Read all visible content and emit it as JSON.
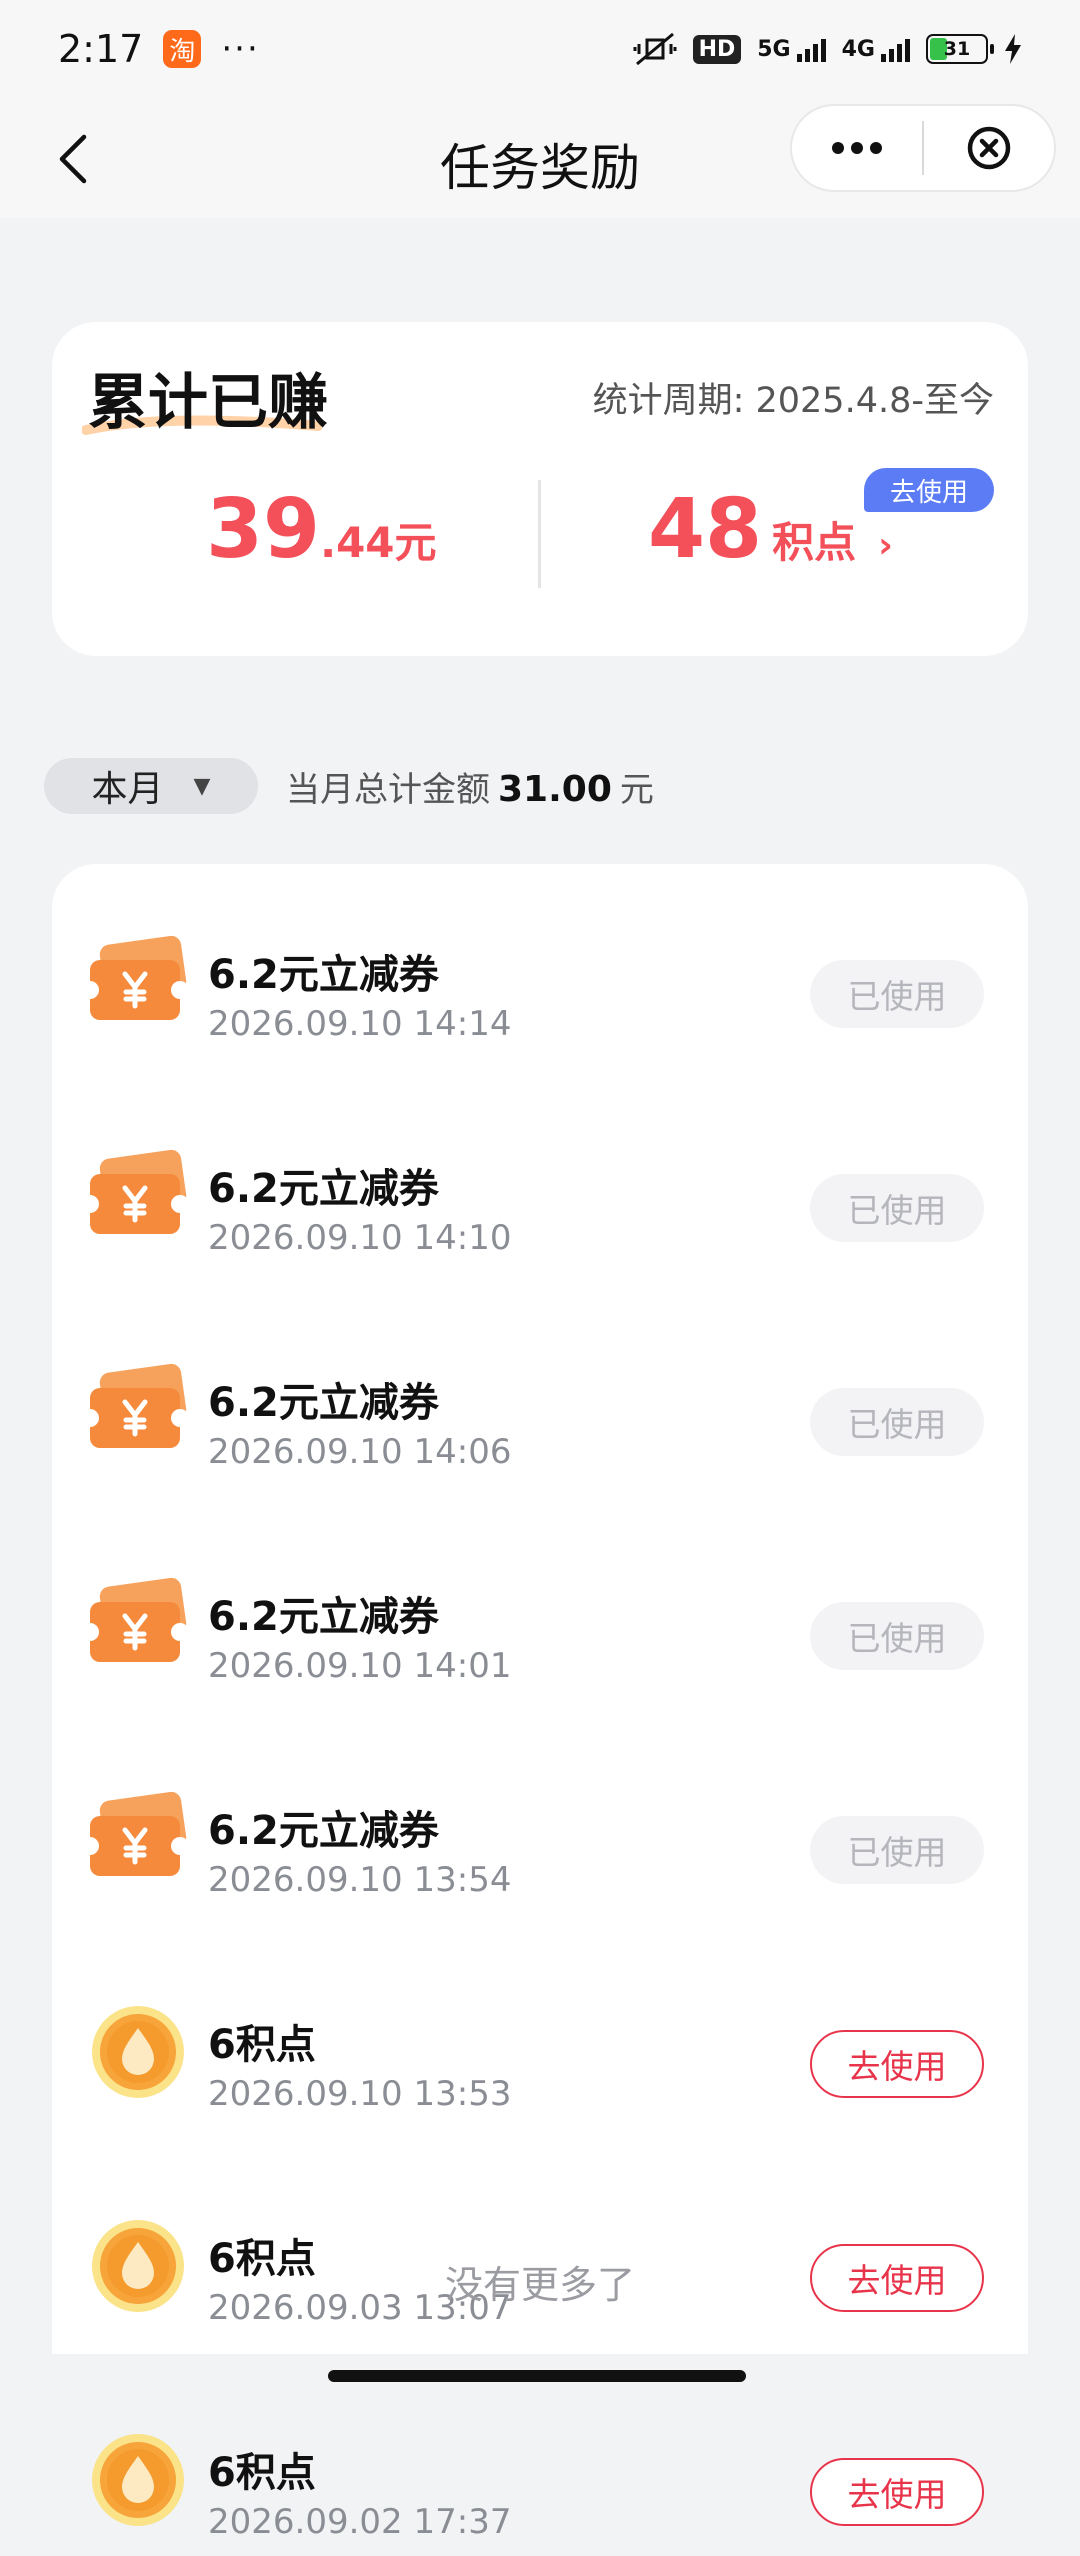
{
  "status_bar": {
    "time": "2:17",
    "app_badge": "淘",
    "more": "···",
    "hd": "HD",
    "net1": "5G",
    "net2": "4G",
    "battery": "31"
  },
  "nav": {
    "title": "任务奖励"
  },
  "summary": {
    "title": "累计已赚",
    "period": "统计周期: 2025.4.8-至今",
    "cash_int": "39",
    "cash_dec": ".44",
    "cash_unit": "元",
    "points_value": "48",
    "points_unit": "积点",
    "points_chevron": "›",
    "use_label": "去使用"
  },
  "filter": {
    "month_label": "本月",
    "month_arrow": "▼",
    "total_prefix": "当月总计金额",
    "total_value": "31.00",
    "total_unit": "元"
  },
  "items": [
    {
      "title": "6.2元立减券",
      "time": "2026.09.10 14:14",
      "button": "已使用",
      "type": "coupon"
    },
    {
      "title": "6.2元立减券",
      "time": "2026.09.10 14:10",
      "button": "已使用",
      "type": "coupon"
    },
    {
      "title": "6.2元立减券",
      "time": "2026.09.10 14:06",
      "button": "已使用",
      "type": "coupon"
    },
    {
      "title": "6.2元立减券",
      "time": "2026.09.10 14:01",
      "button": "已使用",
      "type": "coupon"
    },
    {
      "title": "6.2元立减券",
      "time": "2026.09.10 13:54",
      "button": "已使用",
      "type": "coupon"
    },
    {
      "title": "6积点",
      "time": "2026.09.10 13:53",
      "button": "去使用",
      "type": "points"
    },
    {
      "title": "6积点",
      "time": "2026.09.03 13:07",
      "button": "去使用",
      "type": "points"
    },
    {
      "title": "6积点",
      "time": "2026.09.02 17:37",
      "button": "去使用",
      "type": "points"
    }
  ],
  "footer": {
    "no_more": "没有更多了"
  },
  "icons": {
    "coupon": "coupon-icon",
    "points": "points-drop-icon"
  },
  "colors": {
    "accent_red": "#f4505a",
    "button_red": "#e8344a",
    "blue_pill": "#5b7cf5",
    "coupon_orange": "#f58a3c",
    "points_gold": "#f7c63c"
  }
}
